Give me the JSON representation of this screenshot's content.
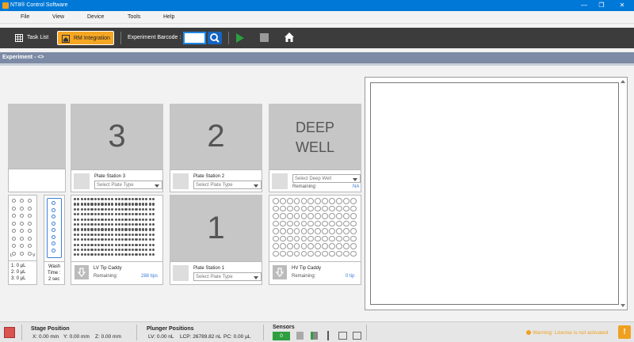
{
  "app": {
    "title": "NT8® Control Software"
  },
  "window": {
    "minimize": "—",
    "maximize": "❐",
    "close": "✕"
  },
  "menu": {
    "items": [
      "File",
      "View",
      "Device",
      "Tools",
      "Help"
    ]
  },
  "toolbar": {
    "task_list": "Task List",
    "rm_integration": "RM Integration",
    "barcode_label": "Experiment Barcode :",
    "barcode_value": ""
  },
  "experiment": {
    "label": "Experiment - <>"
  },
  "deck": {
    "station3": {
      "number": "3",
      "name": "Plate Station 3",
      "select": "Select Plate Type"
    },
    "station2": {
      "number": "2",
      "name": "Plate Station 2",
      "select": "Select Plate Type"
    },
    "station1": {
      "number": "1",
      "name": "Plate Station 1",
      "select": "Select Plate Type"
    },
    "deepwell": {
      "line1": "DEEP",
      "line2": "WELL",
      "select": "Select Deep Well",
      "remaining_label": "Remaining:",
      "remaining_value": "NA"
    },
    "lv_caddy": {
      "name": "LV Tip Caddy",
      "remaining_label": "Remaining:",
      "remaining_value": "288  tips"
    },
    "hv_caddy": {
      "name": "HV Tip Caddy",
      "remaining_label": "Remaining:",
      "remaining_value": "0  tip"
    },
    "reagent": {
      "left": "L",
      "right": "V",
      "vol1": "1: 0 μL",
      "vol2": "2: 0 μL",
      "vol3": "3: 0 μL"
    },
    "wash": {
      "line1": "Wash",
      "line2": "Time :",
      "line3": "2 sec"
    }
  },
  "status": {
    "stage_title": "Stage Position",
    "stage_x": "X: 0.00 mm",
    "stage_y": "Y: 0.00 mm",
    "stage_z": "Z: 0.00 mm",
    "plunger_title": "Plunger Positions",
    "plunger_lv": "LV: 0.00 nL",
    "plunger_lcp": "LCP: 26789.82 nL",
    "plunger_pc": "PC: 0.00 μL",
    "sensors_title": "Sensors",
    "sensor_value": "0",
    "license": "Warning: License is not activated"
  },
  "colors": {
    "accent": "#0078d7",
    "rm_button": "#f5a623",
    "play": "#2e9e3e",
    "link": "#3b7dd8"
  }
}
